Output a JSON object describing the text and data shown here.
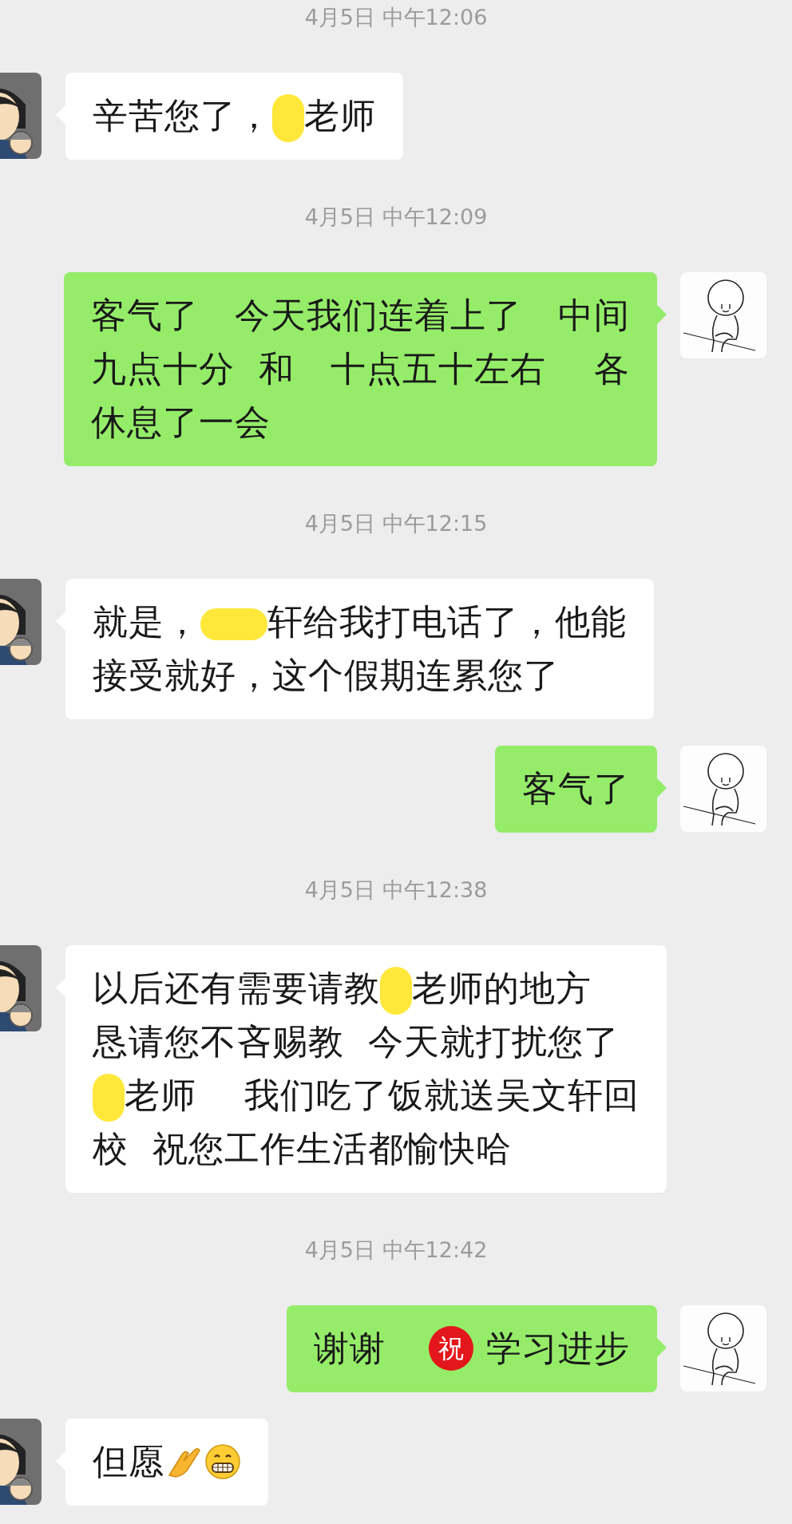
{
  "chat": [
    {
      "kind": "timestamp",
      "text": "4月5日 中午12:06"
    },
    {
      "kind": "message",
      "outgoing": false,
      "content": [
        {
          "kind": "text",
          "lines": [
            [
              {
                "kind": "plain",
                "text": "辛苦您了，"
              },
              {
                "kind": "redaction",
                "wide": false
              },
              {
                "kind": "plain",
                "text": "老师"
              }
            ]
          ]
        }
      ]
    },
    {
      "kind": "timestamp",
      "text": "4月5日 中午12:09"
    },
    {
      "kind": "message",
      "outgoing": true,
      "content": [
        {
          "kind": "text",
          "lines": [
            [
              {
                "kind": "plain",
                "text": "客气了　今天我们连着上了　中间"
              }
            ],
            [
              {
                "kind": "plain",
                "text": "九点十分  和　十点五十左右　 各"
              }
            ],
            [
              {
                "kind": "plain",
                "text": "休息了一会"
              }
            ]
          ]
        }
      ]
    },
    {
      "kind": "timestamp",
      "text": "4月5日 中午12:15"
    },
    {
      "kind": "message",
      "outgoing": false,
      "content": [
        {
          "kind": "text",
          "lines": [
            [
              {
                "kind": "plain",
                "text": "就是，"
              },
              {
                "kind": "redaction",
                "wide": true
              },
              {
                "kind": "plain",
                "text": "轩给我打电话了，他能"
              }
            ],
            [
              {
                "kind": "plain",
                "text": "接受就好，这个假期连累您了"
              }
            ]
          ]
        }
      ]
    },
    {
      "kind": "message",
      "outgoing": true,
      "content": [
        {
          "kind": "text",
          "lines": [
            [
              {
                "kind": "plain",
                "text": "客气了"
              }
            ]
          ]
        }
      ]
    },
    {
      "kind": "timestamp",
      "text": "4月5日 中午12:38"
    },
    {
      "kind": "message",
      "outgoing": false,
      "content": [
        {
          "kind": "text",
          "lines": [
            [
              {
                "kind": "plain",
                "text": "以后还有需要请教"
              },
              {
                "kind": "redaction",
                "wide": false
              },
              {
                "kind": "plain",
                "text": "老师的地方"
              }
            ],
            [
              {
                "kind": "plain",
                "text": "恳请您不吝赐教  今天就打扰您了"
              }
            ],
            [
              {
                "kind": "redaction",
                "wide": false
              },
              {
                "kind": "plain",
                "text": "老师　 我们吃了饭就送吴文轩回"
              }
            ],
            [
              {
                "kind": "plain",
                "text": "校  祝您工作生活都愉快哈"
              }
            ]
          ]
        }
      ]
    },
    {
      "kind": "timestamp",
      "text": "4月5日 中午12:42"
    },
    {
      "kind": "message",
      "outgoing": true,
      "content": [
        {
          "kind": "text",
          "lines": [
            [
              {
                "kind": "plain",
                "text": "谢谢"
              }
            ]
          ]
        },
        {
          "kind": "badge",
          "text": "祝"
        },
        {
          "kind": "text",
          "lines": [
            [
              {
                "kind": "plain",
                "text": "学习进步"
              }
            ]
          ]
        }
      ]
    },
    {
      "kind": "message",
      "outgoing": false,
      "content": [
        {
          "kind": "text",
          "lines": [
            [
              {
                "kind": "plain",
                "text": "但愿"
              }
            ]
          ]
        },
        {
          "kind": "hand"
        },
        {
          "kind": "grin"
        }
      ]
    }
  ]
}
